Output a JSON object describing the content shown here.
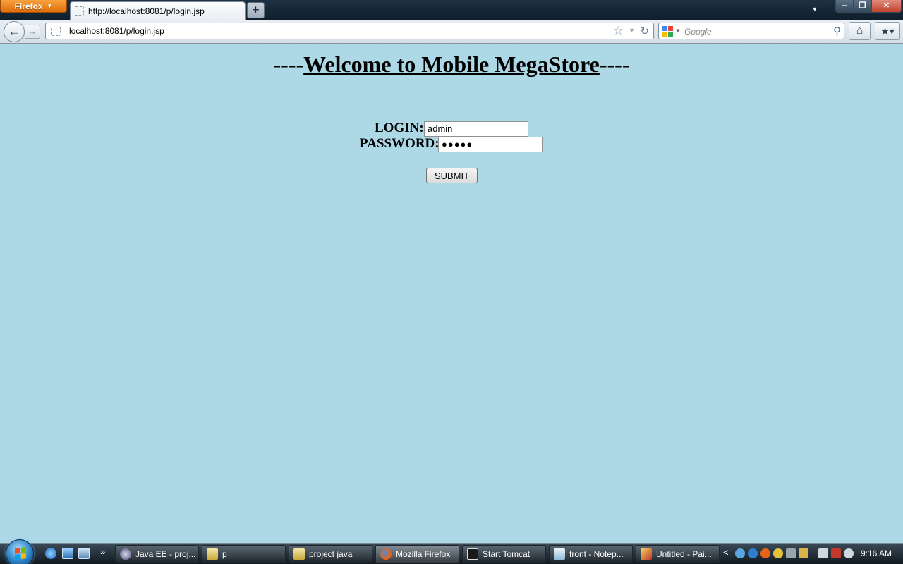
{
  "browser": {
    "menu_label": "Firefox",
    "tab_title": "http://localhost:8081/p/login.jsp",
    "new_tab_symbol": "+",
    "url": "localhost:8081/p/login.jsp",
    "search_placeholder": "Google",
    "icons": [
      "back-arrow-icon",
      "forward-arrow-icon",
      "page-icon",
      "star-icon",
      "reload-icon",
      "google-icon",
      "search-icon",
      "home-icon",
      "bookmarks-icon"
    ]
  },
  "page": {
    "heading_prefix": "----",
    "heading_title": "Welcome to Mobile MegaStore",
    "heading_suffix": "----",
    "login_label": "LOGIN:",
    "login_value": "admin",
    "password_label": "PASSWORD:",
    "password_value": "●●●●●",
    "submit_label": "SUBMIT",
    "background_color": "#add8e6"
  },
  "taskbar": {
    "tasks": [
      {
        "label": "Java EE - proj...",
        "icon": "eclipse-icon"
      },
      {
        "label": "p",
        "icon": "folder-icon"
      },
      {
        "label": "project java",
        "icon": "folder-icon"
      },
      {
        "label": "Mozilla Firefox",
        "icon": "firefox-icon",
        "active": true
      },
      {
        "label": "Start Tomcat",
        "icon": "console-icon"
      },
      {
        "label": "front - Notep...",
        "icon": "notepad-icon"
      },
      {
        "label": "Untitled - Pai...",
        "icon": "paint-icon"
      }
    ],
    "clock": "9:16 AM",
    "quick_launch_more": "»",
    "tray_chevron": "<"
  }
}
